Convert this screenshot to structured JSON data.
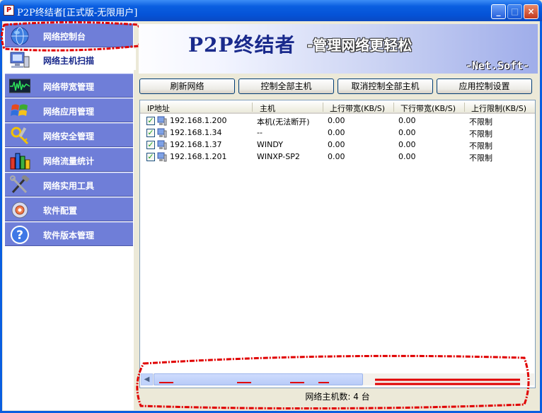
{
  "window": {
    "title": "P2P终结者[正式版-无限用户]",
    "icon": "app-icon",
    "controls": [
      "minimize-icon",
      "maximize-icon",
      "close-icon"
    ]
  },
  "sidebar": {
    "items": [
      {
        "label": "网络控制台",
        "icon": "globe-icon"
      },
      {
        "label": "网络主机扫描",
        "icon": "computer-scan-icon"
      },
      {
        "label": "网络带宽管理",
        "icon": "waveform-icon"
      },
      {
        "label": "网络应用管理",
        "icon": "windows-flag-icon"
      },
      {
        "label": "网络安全管理",
        "icon": "security-tools-icon"
      },
      {
        "label": "网络流量统计",
        "icon": "bar-chart-icon"
      },
      {
        "label": "网络实用工具",
        "icon": "hammer-wrench-icon"
      },
      {
        "label": "软件配置",
        "icon": "config-gear-icon"
      },
      {
        "label": "软件版本管理",
        "icon": "help-icon"
      }
    ]
  },
  "banner": {
    "title": "P2P终结者",
    "slogan": "-管理网络更轻松",
    "brand": "-Net.Soft-"
  },
  "toolbar": {
    "refresh": "刷新网络",
    "control_all": "控制全部主机",
    "uncontrol_all": "取消控制全部主机",
    "apply_settings": "应用控制设置"
  },
  "table": {
    "columns": [
      "IP地址",
      "主机",
      "上行带宽(KB/S)",
      "下行带宽(KB/S)",
      "上行限制(KB/S)"
    ],
    "rows": [
      {
        "checked": true,
        "ip": "192.168.1.200",
        "host": "本机(无法断开)",
        "up": "0.00",
        "down": "0.00",
        "up_limit": "不限制"
      },
      {
        "checked": true,
        "ip": "192.168.1.34",
        "host": "--",
        "up": "0.00",
        "down": "0.00",
        "up_limit": "不限制"
      },
      {
        "checked": true,
        "ip": "192.168.1.37",
        "host": "WINDY",
        "up": "0.00",
        "down": "0.00",
        "up_limit": "不限制"
      },
      {
        "checked": true,
        "ip": "192.168.1.201",
        "host": "WINXP-SP2",
        "up": "0.00",
        "down": "0.00",
        "up_limit": "不限制"
      }
    ]
  },
  "status": {
    "text": "网络主机数: 4 台"
  },
  "colors": {
    "title_bar": "#0553d7",
    "nav_bg": "#6f7ed8",
    "annotation": "#e00000"
  }
}
